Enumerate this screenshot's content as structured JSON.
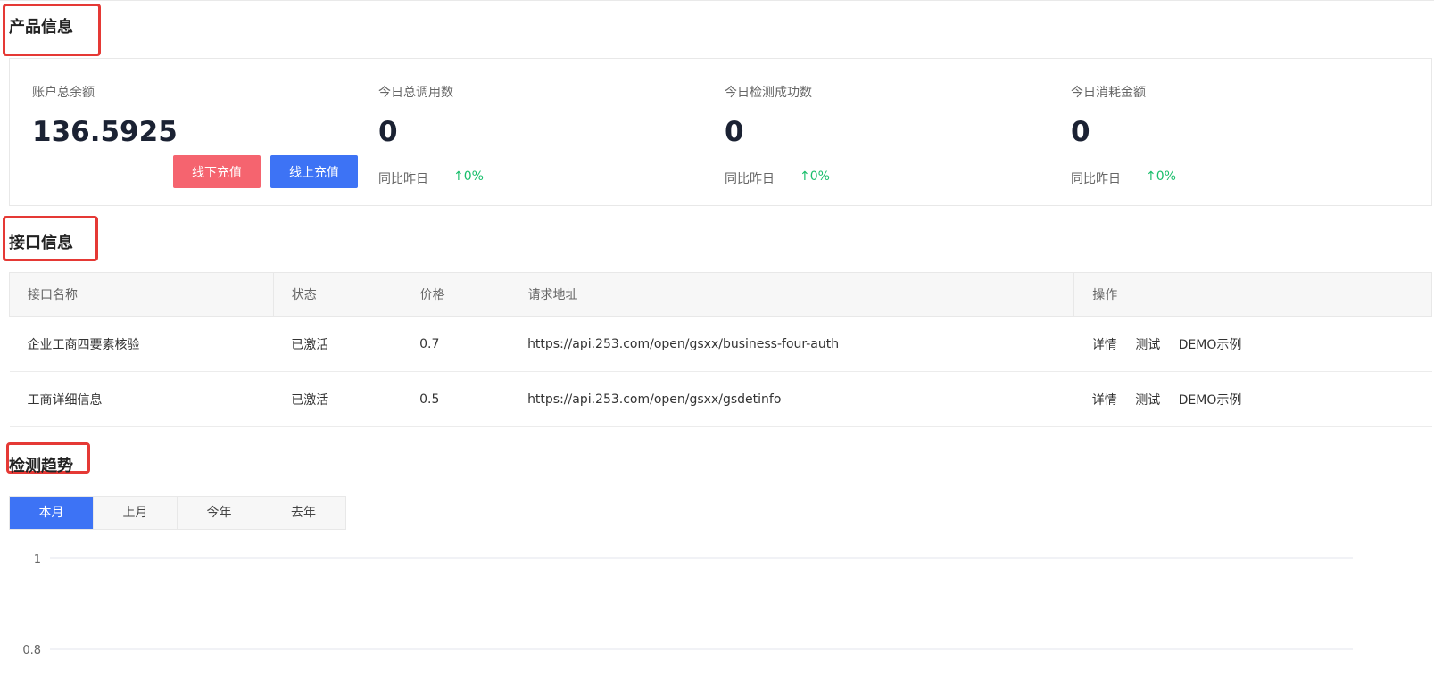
{
  "sections": {
    "product_title": "产品信息",
    "api_title": "接口信息",
    "trend_title": "检测趋势"
  },
  "stats": [
    {
      "label": "账户总余额",
      "value": "136.5925"
    },
    {
      "label": "今日总调用数",
      "value": "0",
      "compare_label": "同比昨日",
      "change": "↑0%"
    },
    {
      "label": "今日检测成功数",
      "value": "0",
      "compare_label": "同比昨日",
      "change": "↑0%"
    },
    {
      "label": "今日消耗金额",
      "value": "0",
      "compare_label": "同比昨日",
      "change": "↑0%"
    }
  ],
  "buttons": {
    "offline_recharge": "线下充值",
    "online_recharge": "线上充值"
  },
  "table": {
    "headers": [
      "接口名称",
      "状态",
      "价格",
      "请求地址",
      "操作"
    ],
    "rows": [
      {
        "name": "企业工商四要素核验",
        "status": "已激活",
        "price": "0.7",
        "url": "https://api.253.com/open/gsxx/business-four-auth"
      },
      {
        "name": "工商详细信息",
        "status": "已激活",
        "price": "0.5",
        "url": "https://api.253.com/open/gsxx/gsdetinfo"
      }
    ],
    "actions": [
      "详情",
      "测试",
      "DEMO示例"
    ]
  },
  "tabs": [
    "本月",
    "上月",
    "今年",
    "去年"
  ],
  "active_tab": "本月",
  "colors": {
    "accent": "#3d73f5",
    "offline_button": "#f5646f",
    "up": "#19be6b",
    "highlight_box": "#e53935"
  },
  "chart_data": {
    "type": "line",
    "x": [],
    "series": [],
    "yticks": [
      "1",
      "0.8"
    ],
    "ylim": [
      0.8,
      1
    ],
    "grid": true,
    "title": "",
    "xlabel": "",
    "ylabel": ""
  }
}
